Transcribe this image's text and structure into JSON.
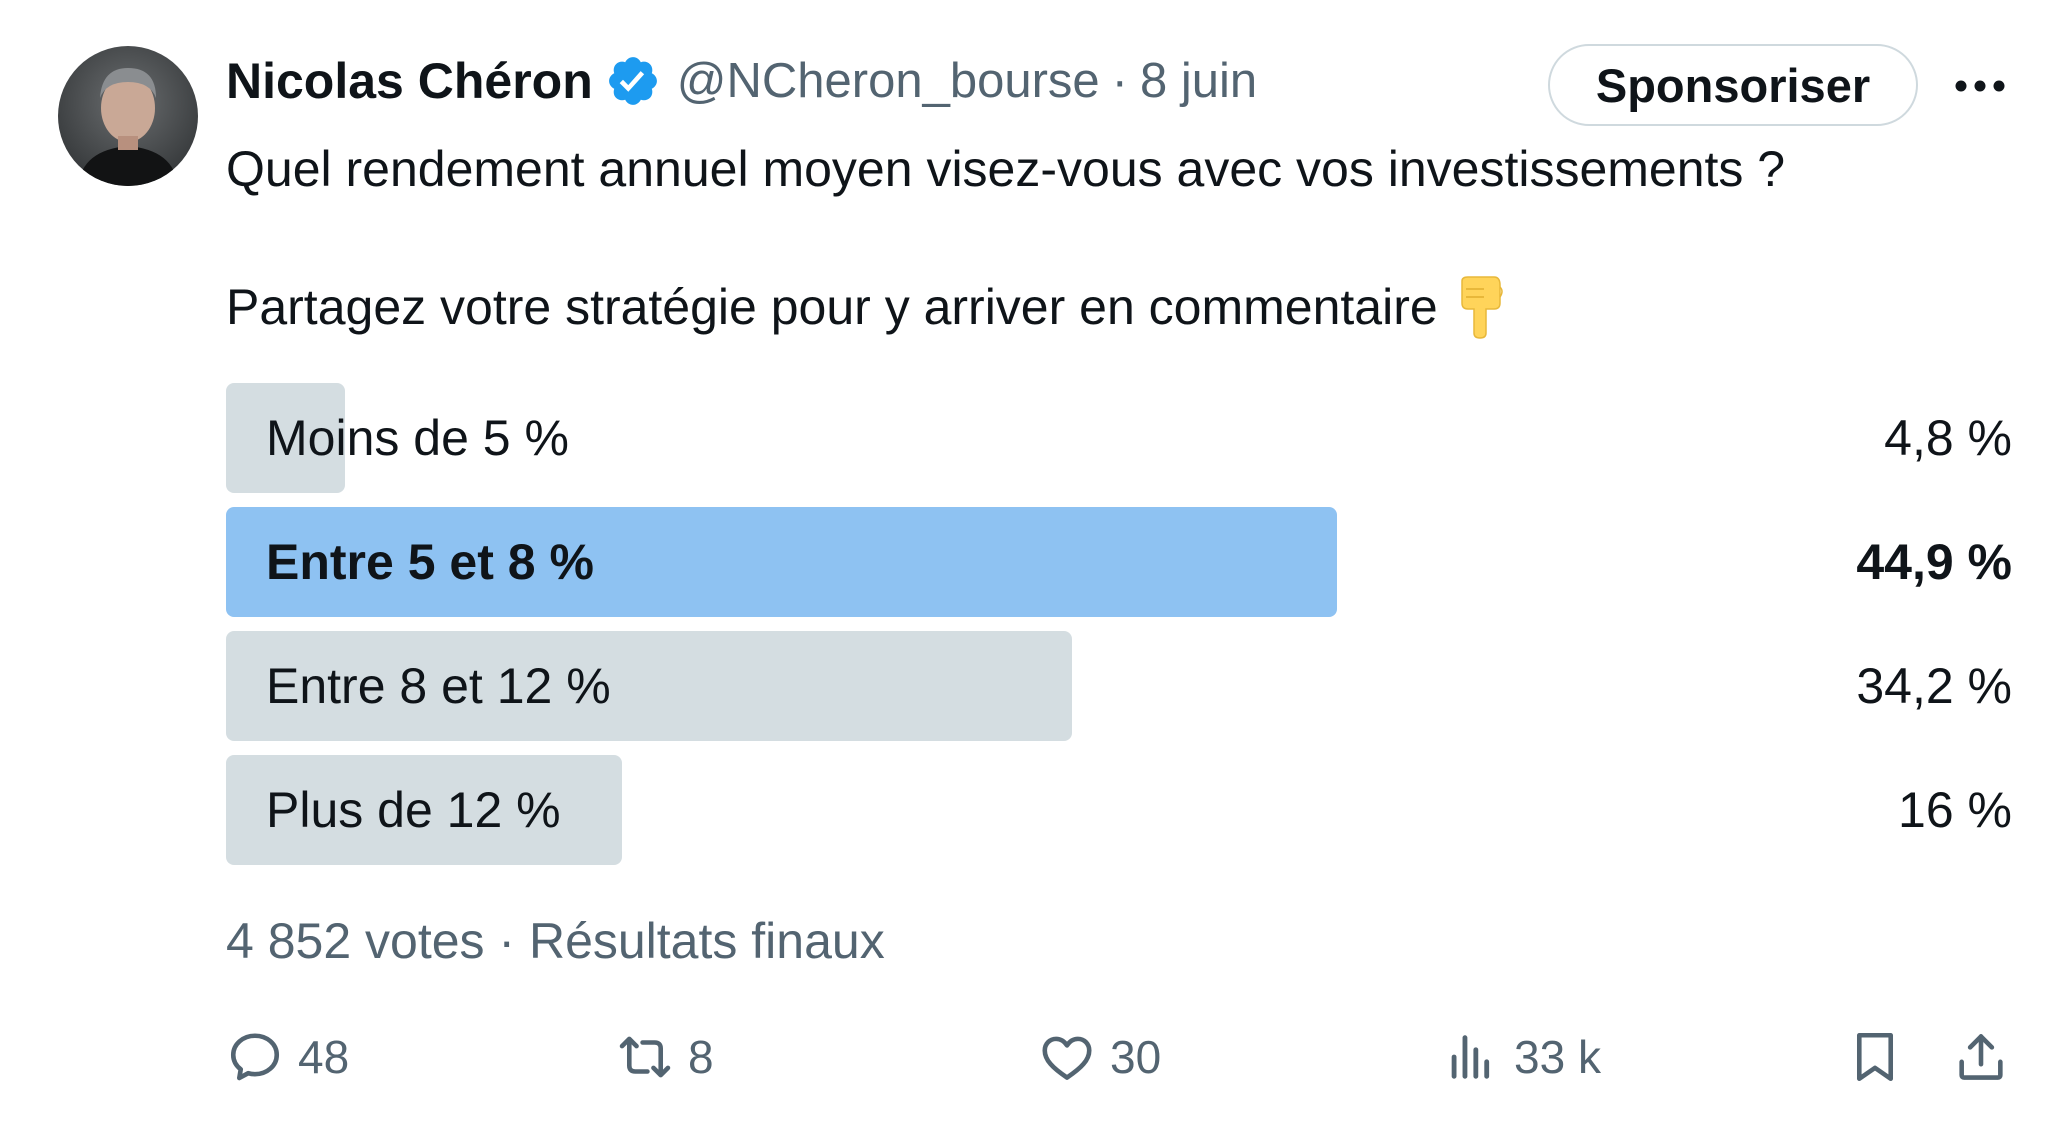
{
  "author": {
    "name": "Nicolas Chéron",
    "handle": "@NCheron_bourse",
    "separator": "·",
    "date": "8 juin",
    "verified_color": "#1d9bf0"
  },
  "header": {
    "sponsor_label": "Sponsoriser",
    "more_icon": "more-dots-icon"
  },
  "tweet": {
    "line1": "Quel rendement annuel moyen visez-vous avec vos investissements ?",
    "line2": "Partagez votre stratégie pour y arriver en commentaire",
    "emoji": "backhand-index-pointing-down-emoji"
  },
  "poll": {
    "options": [
      {
        "label": "Moins de 5 %",
        "percent_label": "4,8 %",
        "percent": 4.8,
        "winner": false
      },
      {
        "label": "Entre 5 et 8 %",
        "percent_label": "44,9 %",
        "percent": 44.9,
        "winner": true
      },
      {
        "label": "Entre 8 et 12 %",
        "percent_label": "34,2 %",
        "percent": 34.2,
        "winner": false
      },
      {
        "label": "Plus de 12 %",
        "percent_label": "16 %",
        "percent": 16,
        "winner": false
      }
    ],
    "footer": "4 852 votes · Résultats finaux",
    "bar_color": "#cfd9de",
    "winner_color": "#8ec2f2"
  },
  "actions": {
    "replies": "48",
    "reposts": "8",
    "likes": "30",
    "views": "33 k"
  }
}
